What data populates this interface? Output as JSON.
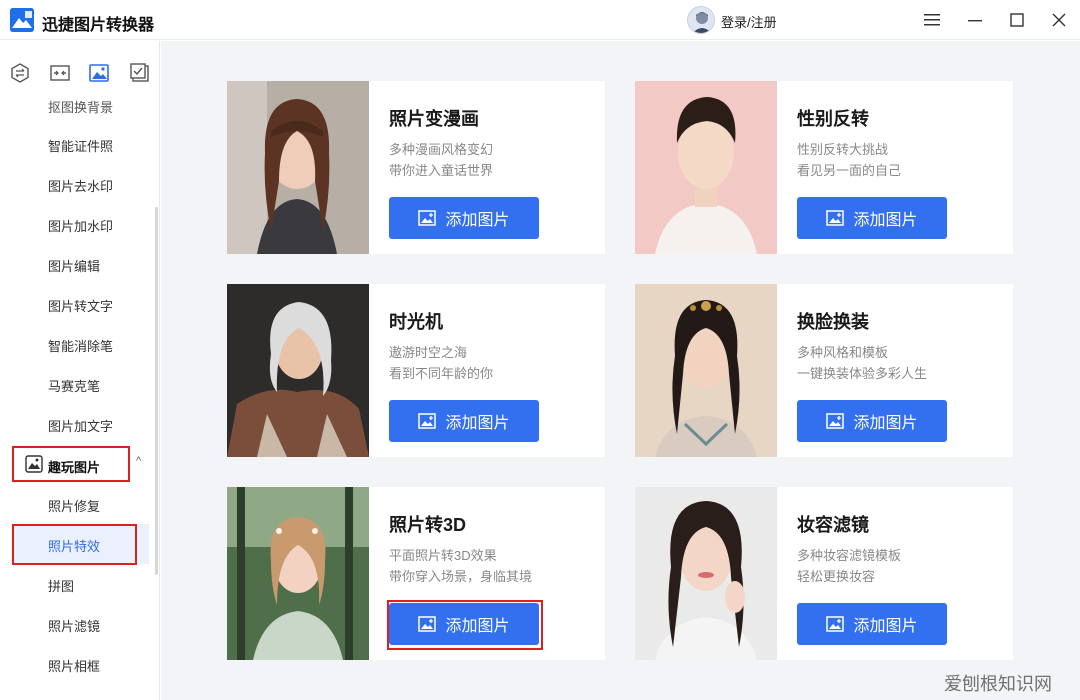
{
  "app": {
    "title": "迅捷图片转换器",
    "login": "登录/注册"
  },
  "icons": {
    "logo": "app-logo-icon",
    "avatar": "user-avatar-icon",
    "menu": "hamburger-menu-icon",
    "minimize": "minimize-icon",
    "maximize": "maximize-icon",
    "close": "close-icon",
    "tabs": [
      "convert-icon",
      "compress-icon",
      "image-icon",
      "check-icon"
    ],
    "group": "picture-group-icon",
    "add_image": "add-image-icon"
  },
  "colors": {
    "accent": "#3370f0",
    "highlight": "#e02020",
    "active_bg": "#eaf1fd"
  },
  "sidebar": {
    "items": [
      {
        "label": "抠图换背景"
      },
      {
        "label": "智能证件照"
      },
      {
        "label": "图片去水印"
      },
      {
        "label": "图片加水印"
      },
      {
        "label": "图片编辑"
      },
      {
        "label": "图片转文字"
      },
      {
        "label": "智能消除笔"
      },
      {
        "label": "马赛克笔"
      },
      {
        "label": "图片加文字"
      }
    ],
    "group": {
      "label": "趣玩图片",
      "arrow": "^"
    },
    "sub_items": [
      {
        "label": "照片修复"
      },
      {
        "label": "照片特效"
      },
      {
        "label": "拼图"
      },
      {
        "label": "照片滤镜"
      },
      {
        "label": "照片相框"
      }
    ],
    "active_index": 1
  },
  "cards": [
    {
      "title": "照片变漫画",
      "desc1": "多种漫画风格变幻",
      "desc2": "带你进入童话世界",
      "button": "添加图片"
    },
    {
      "title": "性别反转",
      "desc1": "性别反转大挑战",
      "desc2": "看见另一面的自己",
      "button": "添加图片"
    },
    {
      "title": "时光机",
      "desc1": "遨游时空之海",
      "desc2": "看到不同年龄的你",
      "button": "添加图片"
    },
    {
      "title": "换脸换装",
      "desc1": "多种风格和模板",
      "desc2": "一键换装体验多彩人生",
      "button": "添加图片"
    },
    {
      "title": "照片转3D",
      "desc1": "平面照片转3D效果",
      "desc2": "带你穿入场景，身临其境",
      "button": "添加图片"
    },
    {
      "title": "妆容滤镜",
      "desc1": "多种妆容滤镜模板",
      "desc2": "轻松更换妆容",
      "button": "添加图片"
    }
  ],
  "watermark": "爱刨根知识网"
}
